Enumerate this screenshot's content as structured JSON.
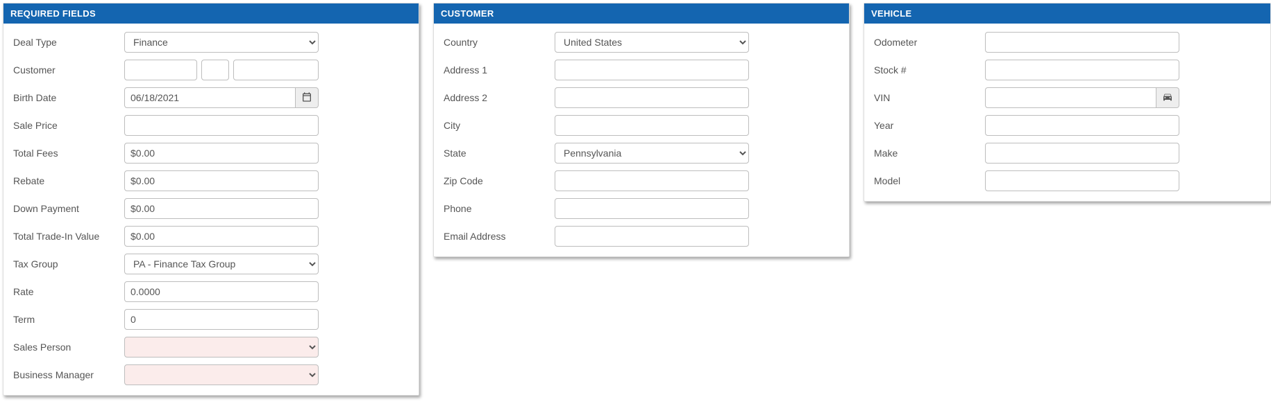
{
  "required": {
    "title": "REQUIRED FIELDS",
    "deal_type_label": "Deal Type",
    "deal_type_value": "Finance",
    "customer_label": "Customer",
    "birth_date_label": "Birth Date",
    "birth_date_value": "06/18/2021",
    "sale_price_label": "Sale Price",
    "sale_price_value": "",
    "total_fees_label": "Total Fees",
    "total_fees_value": "$0.00",
    "rebate_label": "Rebate",
    "rebate_value": "$0.00",
    "down_payment_label": "Down Payment",
    "down_payment_value": "$0.00",
    "trade_in_label": "Total Trade-In Value",
    "trade_in_value": "$0.00",
    "tax_group_label": "Tax Group",
    "tax_group_value": "PA - Finance Tax Group",
    "rate_label": "Rate",
    "rate_value": "0.0000",
    "term_label": "Term",
    "term_value": "0",
    "sales_person_label": "Sales Person",
    "business_manager_label": "Business Manager"
  },
  "customer": {
    "title": "CUSTOMER",
    "country_label": "Country",
    "country_value": "United States",
    "address1_label": "Address 1",
    "address2_label": "Address 2",
    "city_label": "City",
    "state_label": "State",
    "state_value": "Pennsylvania",
    "zip_label": "Zip Code",
    "phone_label": "Phone",
    "email_label": "Email Address"
  },
  "vehicle": {
    "title": "VEHICLE",
    "odometer_label": "Odometer",
    "stock_label": "Stock #",
    "vin_label": "VIN",
    "year_label": "Year",
    "make_label": "Make",
    "model_label": "Model"
  }
}
